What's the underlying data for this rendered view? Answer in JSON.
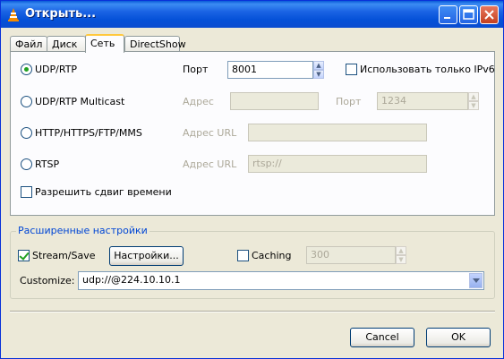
{
  "window": {
    "title": "Открыть..."
  },
  "tabs": [
    {
      "label": "Файл"
    },
    {
      "label": "Диск"
    },
    {
      "label": "Сеть"
    },
    {
      "label": "DirectShow"
    }
  ],
  "network": {
    "udp_rtp_label": "UDP/RTP",
    "port_label": "Порт",
    "port_value": "8001",
    "ipv6_label": "Использовать только IPv6",
    "multicast_label": "UDP/RTP Multicast",
    "address_label": "Адрес",
    "multicast_address_value": "",
    "multicast_port_label": "Порт",
    "multicast_port_value": "1234",
    "http_label": "HTTP/HTTPS/FTP/MMS",
    "http_url_label": "Адрес URL",
    "http_url_value": "",
    "rtsp_label": "RTSP",
    "rtsp_url_label": "Адрес URL",
    "rtsp_url_value": "rtsp://",
    "timeshift_label": "Разрешить сдвиг времени"
  },
  "advanced": {
    "title": "Расширенные настройки",
    "stream_save_label": "Stream/Save",
    "settings_button": "Настройки...",
    "caching_label": "Caching",
    "caching_value": "300",
    "customize_label": "Customize:",
    "customize_value": "udp://@224.10.10.1"
  },
  "buttons": {
    "cancel": "Cancel",
    "ok": "OK"
  }
}
